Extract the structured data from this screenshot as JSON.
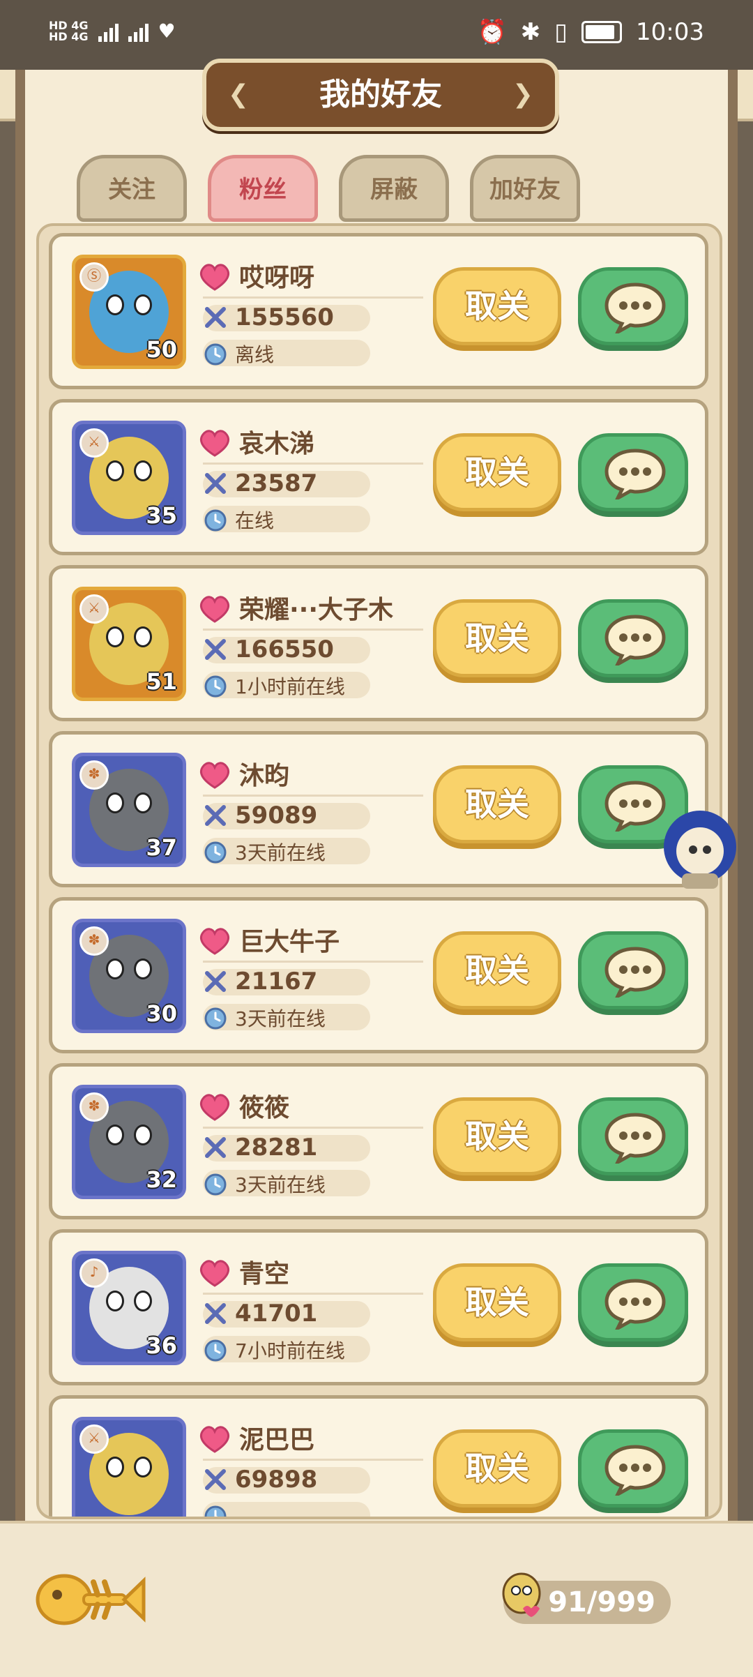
{
  "status_bar": {
    "sim1": "HD 4G",
    "sim2": "HD 4G",
    "time": "10:03"
  },
  "header": {
    "title": "我的好友"
  },
  "tabs": [
    {
      "label": "关注",
      "active": false
    },
    {
      "label": "粉丝",
      "active": true
    },
    {
      "label": "屏蔽",
      "active": false
    },
    {
      "label": "加好友",
      "active": false
    }
  ],
  "friends": [
    {
      "name": "哎呀呀",
      "power": "155560",
      "status": "离线",
      "level": "50"
    },
    {
      "name": "哀木涕",
      "power": "23587",
      "status": "在线",
      "level": "35"
    },
    {
      "name": "荣耀···大子木",
      "power": "166550",
      "status": "1小时前在线",
      "level": "51"
    },
    {
      "name": "沐昀",
      "power": "59089",
      "status": "3天前在线",
      "level": "37"
    },
    {
      "name": "巨大牛子",
      "power": "21167",
      "status": "3天前在线",
      "level": "30"
    },
    {
      "name": "筱筱",
      "power": "28281",
      "status": "3天前在线",
      "level": "32"
    },
    {
      "name": "青空",
      "power": "41701",
      "status": "7小时前在线",
      "level": "36"
    },
    {
      "name": "泥巴巴",
      "power": "69898",
      "status": "",
      "level": ""
    }
  ],
  "buttons": {
    "unfollow_label": "取关"
  },
  "footer": {
    "counter": "91/999"
  },
  "colors": {
    "frame": "#8a7358",
    "panel": "#eadbbd",
    "unfollow_button": "#f9d26a",
    "chat_button": "#5bbd78",
    "active_tab": "#f3b8b5"
  },
  "icons": [
    "heart-icon",
    "sword-icon",
    "clock-icon",
    "chat-bubble-icon",
    "fish-bone-icon",
    "back-arrow-icon"
  ]
}
